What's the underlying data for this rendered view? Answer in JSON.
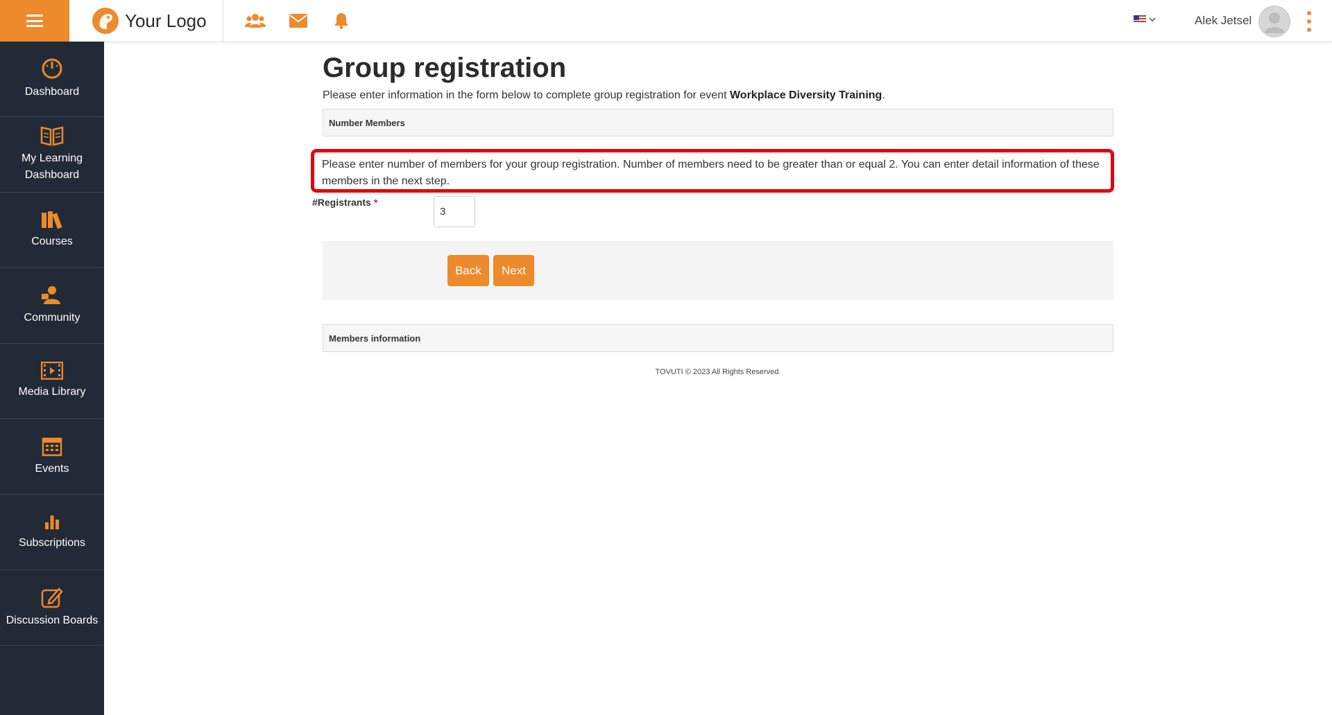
{
  "header": {
    "logo_text": "Your Logo",
    "icons": [
      "users-icon",
      "envelope-icon",
      "bell-icon"
    ],
    "user_name": "Alek Jetsel",
    "language": "en-US"
  },
  "sidebar": {
    "items": [
      {
        "label": "Dashboard",
        "icon": "dashboard-gauge-icon"
      },
      {
        "label": "My Learning Dashboard",
        "icon": "open-book-icon"
      },
      {
        "label": "Courses",
        "icon": "books-icon"
      },
      {
        "label": "Community",
        "icon": "person-teaching-icon"
      },
      {
        "label": "Media Library",
        "icon": "film-icon"
      },
      {
        "label": "Events",
        "icon": "calendar-icon"
      },
      {
        "label": "Subscriptions",
        "icon": "bar-chart-icon"
      },
      {
        "label": "Discussion Boards",
        "icon": "pen-square-icon"
      }
    ]
  },
  "page": {
    "title": "Group registration",
    "intro_prefix": "Please enter information in the form below to complete group registration for event ",
    "event_name": "Workplace Diversity Training",
    "intro_suffix": ".",
    "number_members_heading": "Number Members",
    "instructions": "Please enter number of members for your group registration. Number of members need to be greater than or equal 2. You can enter detail information of these members in the next step.",
    "registrants_label": "#Registrants",
    "required_marker": "*",
    "registrants_value": "3",
    "back_label": "Back",
    "next_label": "Next",
    "members_info_heading": "Members information",
    "footer": "TOVUTI © 2023 All Rights Reserved."
  },
  "colors": {
    "accent": "#ec8a2c",
    "sidebar_bg": "#212a36",
    "highlight": "#e4000f"
  }
}
